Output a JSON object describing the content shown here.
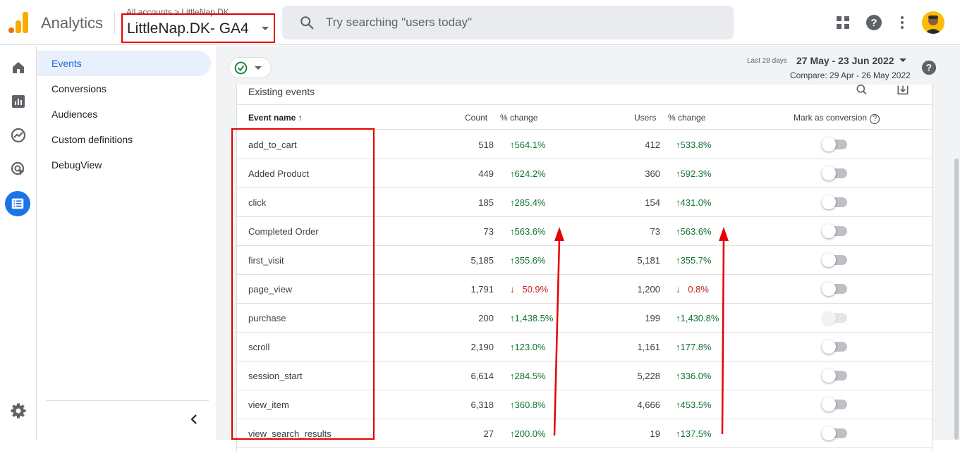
{
  "header": {
    "app_name": "Analytics",
    "breadcrumb": "All accounts > LittleNap.DK",
    "property_name": "LittleNap.DK- GA4",
    "search_placeholder": "Try searching \"users today\""
  },
  "subnav": {
    "items": [
      {
        "label": "Events",
        "active": true
      },
      {
        "label": "Conversions",
        "active": false
      },
      {
        "label": "Audiences",
        "active": false
      },
      {
        "label": "Custom definitions",
        "active": false
      },
      {
        "label": "DebugView",
        "active": false
      }
    ]
  },
  "date": {
    "label": "Last 28 days",
    "range": "27 May - 23 Jun 2022",
    "compare": "Compare: 29 Apr - 26 May 2022"
  },
  "table": {
    "title": "Existing events",
    "headers": {
      "event_name": "Event name",
      "count": "Count",
      "count_change": "% change",
      "users": "Users",
      "users_change": "% change",
      "mark_conversion": "Mark as conversion"
    },
    "rows": [
      {
        "name": "add_to_cart",
        "count": "518",
        "count_change": "564.1%",
        "count_dir": "up",
        "users": "412",
        "users_change": "533.8%",
        "users_dir": "up",
        "toggle": "off"
      },
      {
        "name": "Added Product",
        "count": "449",
        "count_change": "624.2%",
        "count_dir": "up",
        "users": "360",
        "users_change": "592.3%",
        "users_dir": "up",
        "toggle": "off"
      },
      {
        "name": "click",
        "count": "185",
        "count_change": "285.4%",
        "count_dir": "up",
        "users": "154",
        "users_change": "431.0%",
        "users_dir": "up",
        "toggle": "off"
      },
      {
        "name": "Completed Order",
        "count": "73",
        "count_change": "563.6%",
        "count_dir": "up",
        "users": "73",
        "users_change": "563.6%",
        "users_dir": "up",
        "toggle": "off"
      },
      {
        "name": "first_visit",
        "count": "5,185",
        "count_change": "355.6%",
        "count_dir": "up",
        "users": "5,181",
        "users_change": "355.7%",
        "users_dir": "up",
        "toggle": "off"
      },
      {
        "name": "page_view",
        "count": "1,791",
        "count_change": "50.9%",
        "count_dir": "down",
        "users": "1,200",
        "users_change": "0.8%",
        "users_dir": "down",
        "toggle": "off"
      },
      {
        "name": "purchase",
        "count": "200",
        "count_change": "1,438.5%",
        "count_dir": "up",
        "users": "199",
        "users_change": "1,430.8%",
        "users_dir": "up",
        "toggle": "disabled"
      },
      {
        "name": "scroll",
        "count": "2,190",
        "count_change": "123.0%",
        "count_dir": "up",
        "users": "1,161",
        "users_change": "177.8%",
        "users_dir": "up",
        "toggle": "off"
      },
      {
        "name": "session_start",
        "count": "6,614",
        "count_change": "284.5%",
        "count_dir": "up",
        "users": "5,228",
        "users_change": "336.0%",
        "users_dir": "up",
        "toggle": "off"
      },
      {
        "name": "view_item",
        "count": "6,318",
        "count_change": "360.8%",
        "count_dir": "up",
        "users": "4,666",
        "users_change": "453.5%",
        "users_dir": "up",
        "toggle": "off"
      },
      {
        "name": "view_search_results",
        "count": "27",
        "count_change": "200.0%",
        "count_dir": "up",
        "users": "19",
        "users_change": "137.5%",
        "users_dir": "up",
        "toggle": "off"
      }
    ]
  },
  "colors": {
    "accent": "#1a73e8",
    "positive": "#137333",
    "negative": "#c5221f",
    "annotation": "#e60000"
  },
  "icons": [
    "analytics-logo-icon",
    "search-icon",
    "apps-grid-icon",
    "help-icon",
    "more-vert-icon",
    "home-icon",
    "reports-icon",
    "explore-icon",
    "advertising-icon",
    "configure-icon",
    "settings-gear-icon",
    "collapse-chevron-icon",
    "check-circle-icon",
    "download-icon",
    "sort-arrow-up-icon"
  ]
}
